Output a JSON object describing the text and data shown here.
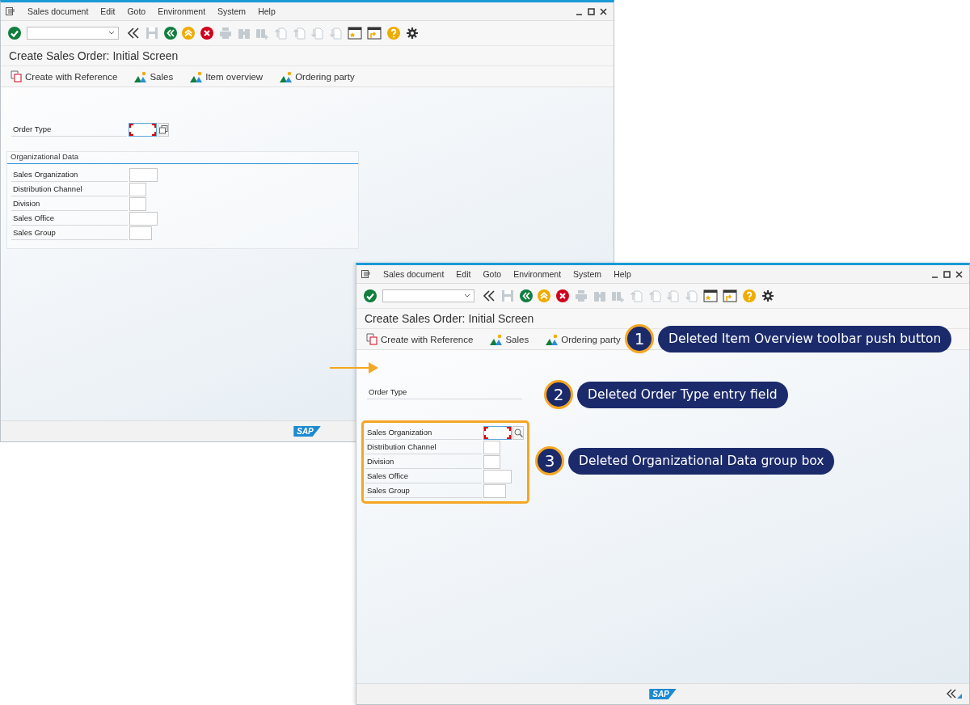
{
  "windows": [
    {
      "menu": [
        "Sales document",
        "Edit",
        "Goto",
        "Environment",
        "System",
        "Help"
      ],
      "toolbar": [
        {
          "kind": "enter",
          "disabled": false
        },
        {
          "kind": "field",
          "disabled": false
        },
        {
          "kind": "collapse",
          "disabled": false
        },
        {
          "kind": "save",
          "disabled": true
        },
        {
          "kind": "back",
          "disabled": false
        },
        {
          "kind": "exit",
          "disabled": false
        },
        {
          "kind": "cancel",
          "disabled": false
        },
        {
          "kind": "print",
          "disabled": true
        },
        {
          "kind": "find",
          "disabled": true
        },
        {
          "kind": "find_next",
          "disabled": true
        },
        {
          "kind": "first_page",
          "disabled": true
        },
        {
          "kind": "prev_page",
          "disabled": true
        },
        {
          "kind": "next_page",
          "disabled": true
        },
        {
          "kind": "last_page",
          "disabled": true
        },
        {
          "kind": "new_session",
          "disabled": false
        },
        {
          "kind": "shortcut",
          "disabled": false
        },
        {
          "kind": "help",
          "disabled": false
        },
        {
          "kind": "settings",
          "disabled": false
        }
      ],
      "title": "Create Sales Order: Initial Screen",
      "app_buttons": [
        {
          "label": "Create with Reference",
          "kind": "reference"
        },
        {
          "label": "Sales",
          "kind": "overview"
        },
        {
          "label": "Item overview",
          "kind": "overview"
        },
        {
          "label": "Ordering party",
          "kind": "overview"
        }
      ],
      "order_type": {
        "label": "Order Type",
        "field": true,
        "focused": true,
        "help_button": {
          "kind": "select"
        }
      },
      "org_data": {
        "kind": "group_box",
        "title": "Organizational Data",
        "highlighted": false,
        "fields": [
          {
            "label": "Sales Organization",
            "kind": "wide",
            "focused": false
          },
          {
            "label": "Distribution Channel",
            "kind": "narrow",
            "focused": false
          },
          {
            "label": "Division",
            "kind": "narrow",
            "focused": false
          },
          {
            "label": "Sales Office",
            "kind": "wide",
            "focused": false
          },
          {
            "label": "Sales Group",
            "kind": "medium",
            "focused": false
          }
        ]
      },
      "footer": {
        "logo": "SAP"
      }
    },
    {
      "menu": [
        "Sales document",
        "Edit",
        "Goto",
        "Environment",
        "System",
        "Help"
      ],
      "toolbar": [
        {
          "kind": "enter",
          "disabled": false
        },
        {
          "kind": "field",
          "disabled": false
        },
        {
          "kind": "collapse",
          "disabled": false
        },
        {
          "kind": "save",
          "disabled": true
        },
        {
          "kind": "back",
          "disabled": false
        },
        {
          "kind": "exit",
          "disabled": false
        },
        {
          "kind": "cancel",
          "disabled": false
        },
        {
          "kind": "print",
          "disabled": true
        },
        {
          "kind": "find",
          "disabled": true
        },
        {
          "kind": "find_next",
          "disabled": true
        },
        {
          "kind": "first_page",
          "disabled": true
        },
        {
          "kind": "prev_page",
          "disabled": true
        },
        {
          "kind": "next_page",
          "disabled": true
        },
        {
          "kind": "last_page",
          "disabled": true
        },
        {
          "kind": "new_session",
          "disabled": false
        },
        {
          "kind": "shortcut",
          "disabled": false
        },
        {
          "kind": "help",
          "disabled": false
        },
        {
          "kind": "settings",
          "disabled": false
        }
      ],
      "title": "Create Sales Order: Initial Screen",
      "app_buttons": [
        {
          "label": "Create with Reference",
          "kind": "reference"
        },
        {
          "label": "Sales",
          "kind": "overview"
        },
        {
          "label": "Ordering party",
          "kind": "overview"
        }
      ],
      "order_type": {
        "label": "Order Type",
        "field": false
      },
      "org_data": {
        "kind": "plain",
        "highlighted": true,
        "fields": [
          {
            "label": "Sales Organization",
            "kind": "wide",
            "focused": true,
            "help_button": {
              "kind": "search"
            }
          },
          {
            "label": "Distribution Channel",
            "kind": "narrow",
            "focused": false
          },
          {
            "label": "Division",
            "kind": "narrow",
            "focused": false
          },
          {
            "label": "Sales Office",
            "kind": "wide",
            "focused": false
          },
          {
            "label": "Sales Group",
            "kind": "medium",
            "focused": false
          }
        ]
      },
      "footer": {
        "logo": "SAP",
        "collapse": true
      }
    }
  ],
  "callouts": [
    {
      "number": "1",
      "text": "Deleted Item Overview toolbar push button"
    },
    {
      "number": "2",
      "text": "Deleted Order Type entry field"
    },
    {
      "number": "3",
      "text": "Deleted Organizational Data group box"
    }
  ]
}
